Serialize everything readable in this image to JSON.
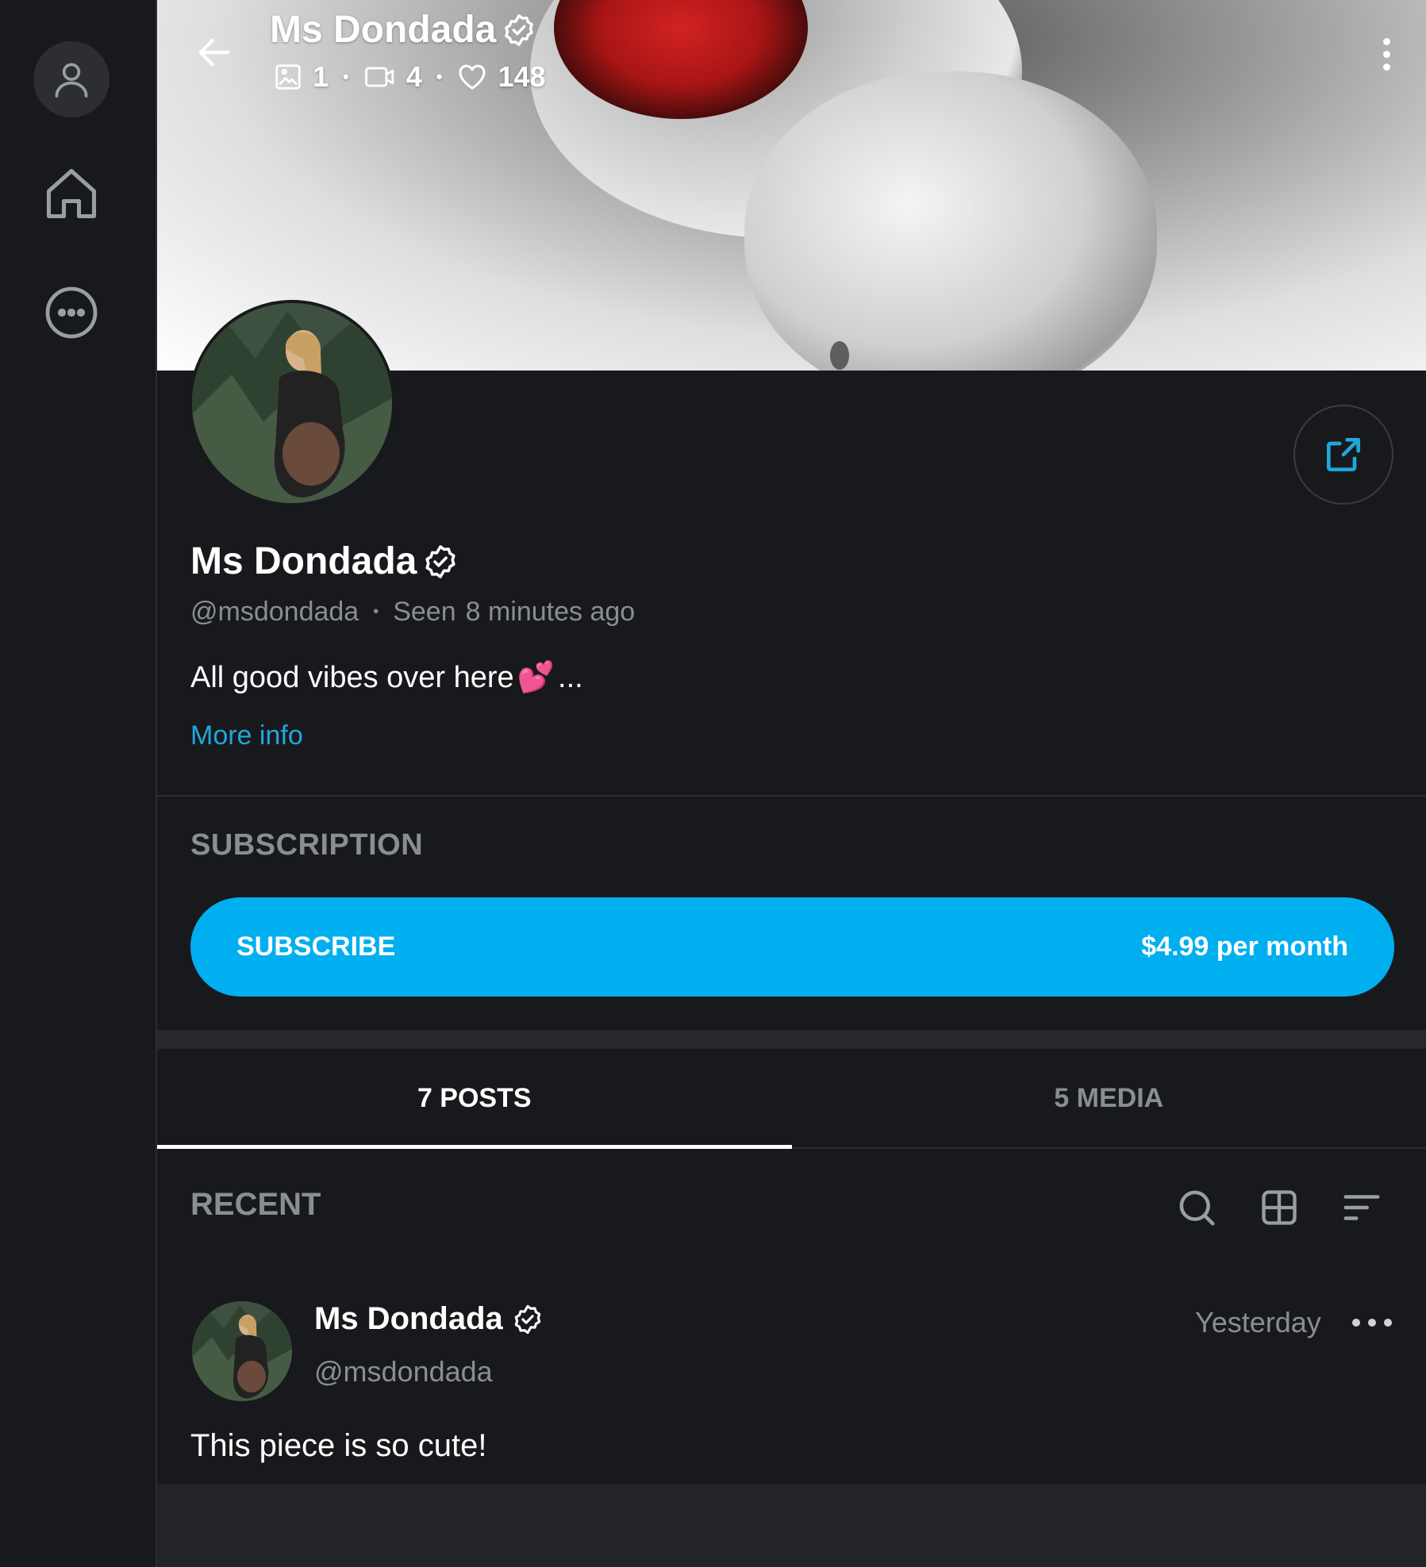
{
  "profile": {
    "name": "Ms Dondada",
    "handle": "@msdondada",
    "seen_label": "Seen",
    "seen_time": "8 minutes ago",
    "bio": "All good vibes over here",
    "bio_emoji": "💕",
    "bio_ellipsis": "...",
    "more_info": "More info"
  },
  "header": {
    "title": "Ms Dondada",
    "photos_count": "1",
    "videos_count": "4",
    "likes_count": "148"
  },
  "subscription": {
    "section_label": "SUBSCRIPTION",
    "button_label": "SUBSCRIBE",
    "price": "$4.99 per month"
  },
  "tabs": [
    {
      "label": "7 POSTS",
      "active": true
    },
    {
      "label": "5 MEDIA",
      "active": false
    }
  ],
  "feed": {
    "section_label": "RECENT",
    "post": {
      "author": "Ms Dondada",
      "handle": "@msdondada",
      "time": "Yesterday",
      "text": "This piece is so cute!"
    }
  },
  "colors": {
    "accent": "#00aff0",
    "link": "#1fa7dc",
    "background": "#18191c",
    "muted_text": "#8a8d93"
  },
  "icons": [
    "user-icon",
    "home-icon",
    "more-circle-icon",
    "back-arrow-icon",
    "verified-icon",
    "image-icon",
    "video-icon",
    "heart-icon",
    "kebab-menu-icon",
    "share-icon",
    "search-icon",
    "grid-icon",
    "sort-icon",
    "more-horizontal-icon"
  ]
}
